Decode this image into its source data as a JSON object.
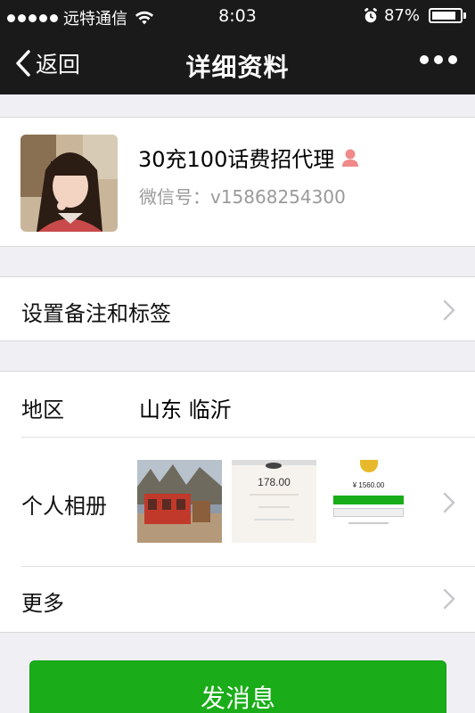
{
  "status_bar": {
    "carrier": "远特通信",
    "time": "8:03",
    "battery_percent_label": "87%",
    "battery_level": 0.87
  },
  "nav": {
    "back_label": "返回",
    "title": "详细资料"
  },
  "profile": {
    "name": "30充100话费招代理",
    "wechat_id": "微信号：v15868254300",
    "gender_icon": "female-icon"
  },
  "remark_row": {
    "label": "设置备注和标签"
  },
  "region_row": {
    "label": "地区",
    "value": "山东  临沂"
  },
  "album_row": {
    "label": "个人相册",
    "thumbs": [
      {
        "kind": "photo",
        "icon": "photo-icon"
      },
      {
        "kind": "payment-screenshot",
        "amount": "178.00"
      },
      {
        "kind": "payment-screenshot",
        "amount": "¥ 1560.00"
      }
    ]
  },
  "more_row": {
    "label": "更多"
  },
  "actions": {
    "send_message_label": "发消息"
  },
  "colors": {
    "bar_bg": "#1a1a1a",
    "page_bg": "#efeff4",
    "primary_green": "#1aad19",
    "secondary_text": "#9a9a9a"
  }
}
